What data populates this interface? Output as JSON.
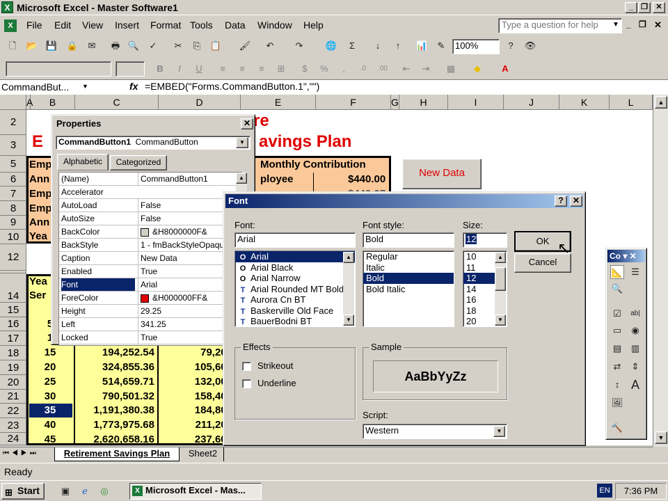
{
  "window": {
    "title": "Microsoft Excel - Master Software1",
    "help_placeholder": "Type a question for help"
  },
  "menu": [
    "File",
    "Edit",
    "View",
    "Insert",
    "Format",
    "Tools",
    "Data",
    "Window",
    "Help"
  ],
  "toolbar": {
    "zoom": "100%"
  },
  "formula_bar": {
    "name_box": "CommandBut...",
    "fx": "fx",
    "formula": "=EMBED(\"Forms.CommandButton.1\",\"\")"
  },
  "columns": [
    "A",
    "B",
    "C",
    "D",
    "E",
    "F",
    "G",
    "H",
    "I",
    "J",
    "K",
    "L"
  ],
  "rows": [
    "2",
    "3",
    "5",
    "6",
    "7",
    "8",
    "9",
    "10",
    "12",
    "13",
    "14",
    "15",
    "16",
    "17",
    "18",
    "19",
    "20",
    "21",
    "22",
    "23",
    "24"
  ],
  "sheet": {
    "title_line1": "re",
    "title_line2_left": "E",
    "title_line2_right": "avings Plan",
    "monthly_contribution": "Monthly Contribution",
    "employee_label": "ployee",
    "employee_value": "$440.00",
    "partial_value": "$440.07",
    "left_labels": [
      "Emp",
      "Ann",
      "Emp",
      "Emp",
      "Ann",
      "Yea"
    ],
    "new_data_button": "New Data",
    "year_header1": "Yea",
    "year_header2": "Ser",
    "data_rows": [
      {
        "year": "5",
        "c": "",
        "d": ""
      },
      {
        "year": "1",
        "c": "",
        "d": ""
      },
      {
        "year": "15",
        "c": "194,252.54",
        "d": "79,200"
      },
      {
        "year": "20",
        "c": "324,855.36",
        "d": "105,600"
      },
      {
        "year": "25",
        "c": "514,659.71",
        "d": "132,000"
      },
      {
        "year": "30",
        "c": "790,501.32",
        "d": "158,400"
      },
      {
        "year": "35",
        "c": "1,191,380.38",
        "d": "184,800"
      },
      {
        "year": "40",
        "c": "1,773,975.68",
        "d": "211,200"
      },
      {
        "year": "45",
        "c": "2,620,658.16",
        "d": "237,600"
      }
    ]
  },
  "properties": {
    "title": "Properties",
    "object": "CommandButton1",
    "object_type": "CommandButton",
    "tabs": [
      "Alphabetic",
      "Categorized"
    ],
    "rows": [
      {
        "k": "(Name)",
        "v": "CommandButton1"
      },
      {
        "k": "Accelerator",
        "v": ""
      },
      {
        "k": "AutoLoad",
        "v": "False"
      },
      {
        "k": "AutoSize",
        "v": "False"
      },
      {
        "k": "BackColor",
        "v": "&H8000000F&"
      },
      {
        "k": "BackStyle",
        "v": "1 - fmBackStyleOpaque"
      },
      {
        "k": "Caption",
        "v": "New Data"
      },
      {
        "k": "Enabled",
        "v": "True"
      },
      {
        "k": "Font",
        "v": "Arial"
      },
      {
        "k": "ForeColor",
        "v": "&H000000FF&"
      },
      {
        "k": "Height",
        "v": "29.25"
      },
      {
        "k": "Left",
        "v": "341.25"
      },
      {
        "k": "Locked",
        "v": "True"
      }
    ]
  },
  "font_dialog": {
    "title": "Font",
    "font_label": "Font:",
    "font_value": "Arial",
    "fonts": [
      "Arial",
      "Arial Black",
      "Arial Narrow",
      "Arial Rounded MT Bold",
      "Aurora Cn BT",
      "Baskerville Old Face",
      "BauerBodni BT"
    ],
    "style_label": "Font style:",
    "style_value": "Bold",
    "styles": [
      "Regular",
      "Italic",
      "Bold",
      "Bold Italic"
    ],
    "size_label": "Size:",
    "size_value": "12",
    "sizes": [
      "10",
      "11",
      "12",
      "14",
      "16",
      "18",
      "20"
    ],
    "ok": "OK",
    "cancel": "Cancel",
    "effects_label": "Effects",
    "strikeout": "Strikeout",
    "underline": "Underline",
    "sample_label": "Sample",
    "sample_text": "AaBbYyZz",
    "script_label": "Script:",
    "script_value": "Western"
  },
  "toolbox": {
    "title": "Co"
  },
  "sheet_tabs": [
    "Retirement Savings Plan",
    "Sheet2"
  ],
  "status": "Ready",
  "taskbar": {
    "start": "Start",
    "task": "Microsoft Excel - Mas...",
    "lang": "EN",
    "time": "7:36 PM"
  },
  "colors": {
    "title_red": "#e00000",
    "header_tan": "#fbc899",
    "data_yellow": "#ffff99",
    "selection_blue": "#0a246a",
    "excel_green": "#1c7a3a"
  }
}
